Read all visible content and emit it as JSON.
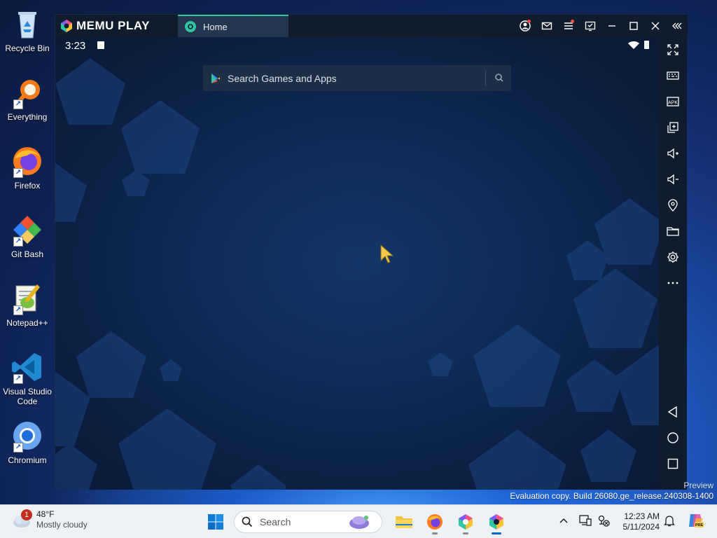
{
  "desktop": {
    "icons": [
      {
        "label": "Recycle Bin",
        "icon": "recycle-bin-icon"
      },
      {
        "label": "Everything",
        "icon": "everything-icon"
      },
      {
        "label": "Firefox",
        "icon": "firefox-icon"
      },
      {
        "label": "Git Bash",
        "icon": "git-bash-icon"
      },
      {
        "label": "Notepad++",
        "icon": "notepad-plus-plus-icon"
      },
      {
        "label": "Visual Studio Code",
        "icon": "vscode-icon"
      },
      {
        "label": "Chromium",
        "icon": "chromium-icon"
      }
    ]
  },
  "emulator": {
    "brand": "MEMU PLAY",
    "tab_label": "Home",
    "title_actions": [
      "account-icon",
      "mail-icon",
      "menu-icon",
      "screen-share-icon",
      "minimize-icon",
      "maximize-icon",
      "close-icon",
      "collapse-sidebar-icon"
    ],
    "status": {
      "time": "3:23"
    },
    "search_placeholder": "Search Games and Apps",
    "sidebar": [
      "fullscreen-icon",
      "keyboard-mapping-icon",
      "apk-install-icon",
      "multi-instance-icon",
      "volume-up-icon",
      "volume-down-icon",
      "location-icon",
      "folder-icon",
      "settings-icon",
      "more-icon",
      "back-icon",
      "home-icon",
      "recents-icon"
    ],
    "sidebar_apk_text": "APK"
  },
  "watermark": {
    "line1": "Preview",
    "line2": "Evaluation copy. Build 26080.ge_release.240308-1400"
  },
  "taskbar": {
    "weather": {
      "badge": "1",
      "temp": "48°F",
      "condition": "Mostly cloudy"
    },
    "search_label": "Search",
    "apps": [
      "file-explorer-icon",
      "firefox-icon",
      "memu-multi-icon",
      "memu-play-icon"
    ],
    "clock": {
      "time": "12:23 AM",
      "date": "5/11/2024"
    }
  },
  "colors": {
    "accent": "#2ec7a1",
    "titlebar": "#0f1c2e",
    "screen": "#0f2b55",
    "taskbar": "#eef1f6"
  }
}
